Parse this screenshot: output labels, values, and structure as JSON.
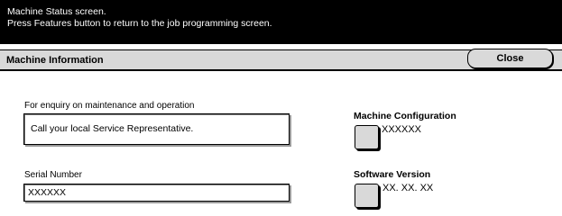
{
  "message": {
    "line1": "Machine Status screen.",
    "line2": "Press Features button to return to the job programming screen."
  },
  "header": {
    "title": "Machine Information",
    "close_label": "Close"
  },
  "maintenance": {
    "label": "For enquiry on maintenance and operation",
    "value": "Call your local Service Representative."
  },
  "serial": {
    "label": "Serial Number",
    "value": "XXXXXX"
  },
  "machine_config": {
    "label": "Machine Configuration",
    "value": "XXXXXX"
  },
  "software_version": {
    "label": "Software Version",
    "value": "XX. XX. XX"
  }
}
